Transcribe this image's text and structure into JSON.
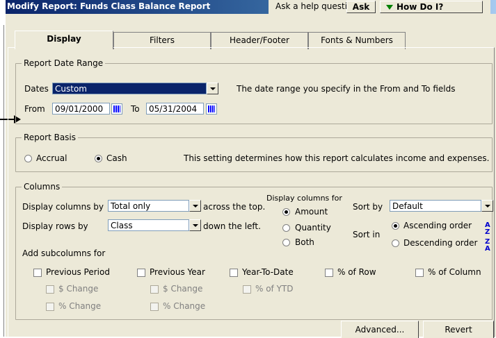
{
  "window": {
    "title": "Modify Report: Funds Class Balance Report",
    "help_prompt": "Ask a help question",
    "ask_label": "Ask",
    "how_do_i_label": "How Do I?"
  },
  "tabs": [
    {
      "label": "Display",
      "active": true
    },
    {
      "label": "Filters"
    },
    {
      "label": "Header/Footer"
    },
    {
      "label": "Fonts & Numbers"
    }
  ],
  "date_range": {
    "group_label": "Report Date Range",
    "dates_label": "Dates",
    "dates_value": "Custom",
    "hint": "The date range you specify in the From and To fields",
    "from_label": "From",
    "from_value": "09/01/2000",
    "to_label": "To",
    "to_value": "05/31/2004"
  },
  "report_basis": {
    "group_label": "Report Basis",
    "accrual_label": "Accrual",
    "cash_label": "Cash",
    "selected": "Cash",
    "hint": "This setting determines how this report calculates income and expenses."
  },
  "columns": {
    "group_label": "Columns",
    "display_columns_by_label": "Display columns by",
    "display_columns_by_value": "Total only",
    "across_label": "across the top.",
    "display_rows_by_label": "Display rows by",
    "display_rows_by_value": "Class",
    "down_label": "down the left.",
    "display_columns_for_label": "Display columns for",
    "amount_label": "Amount",
    "quantity_label": "Quantity",
    "both_label": "Both",
    "sort_by_label": "Sort by",
    "sort_by_value": "Default",
    "sort_in_label": "Sort in",
    "ascending_label": "Ascending order",
    "descending_label": "Descending order",
    "add_subcolumns_label": "Add subcolumns for",
    "subcolumns": {
      "previous_period": "Previous Period",
      "previous_year": "Previous Year",
      "year_to_date": "Year-To-Date",
      "pct_row": "% of Row",
      "pct_column": "% of Column",
      "pp_dollar_change": "$ Change",
      "pp_pct_change": "% Change",
      "py_dollar_change": "$ Change",
      "py_pct_change": "% Change",
      "pct_ytd": "% of YTD"
    }
  },
  "buttons": {
    "advanced": "Advanced...",
    "revert": "Revert"
  }
}
